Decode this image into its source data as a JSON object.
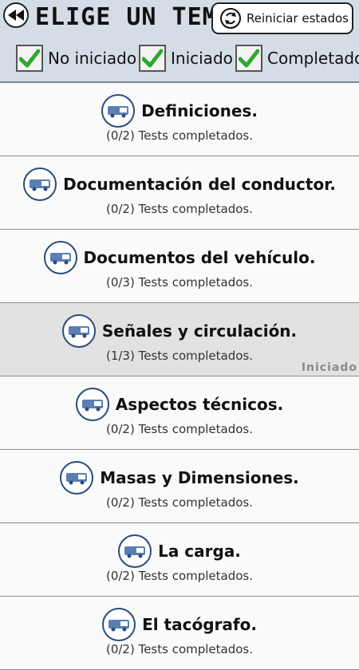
{
  "header": {
    "title": "ELIGE UN TEMA:",
    "reset_label": "Reiniciar estados",
    "filters": [
      {
        "label": "No iniciado",
        "checked": true
      },
      {
        "label": "Iniciado",
        "checked": true
      },
      {
        "label": "Completado",
        "checked": true
      }
    ]
  },
  "topics": [
    {
      "title": "Definiciones.",
      "sub": "(0/2) Tests completados.",
      "status": ""
    },
    {
      "title": "Documentación del conductor.",
      "sub": "(0/2) Tests completados.",
      "status": ""
    },
    {
      "title": "Documentos del vehículo.",
      "sub": "(0/3) Tests completados.",
      "status": ""
    },
    {
      "title": "Señales y circulación.",
      "sub": "(1/3) Tests completados.",
      "status": "Iniciado"
    },
    {
      "title": "Aspectos técnicos.",
      "sub": "(0/2) Tests completados.",
      "status": ""
    },
    {
      "title": "Masas y Dimensiones.",
      "sub": "(0/2) Tests completados.",
      "status": ""
    },
    {
      "title": "La carga.",
      "sub": "(0/2) Tests completados.",
      "status": ""
    },
    {
      "title": "El tacógrafo.",
      "sub": "(0/2) Tests completados.",
      "status": ""
    }
  ],
  "colors": {
    "accent_check": "#2fa82f",
    "icon_ring": "#2c4c7c",
    "header_bg": "#d4dde6"
  }
}
